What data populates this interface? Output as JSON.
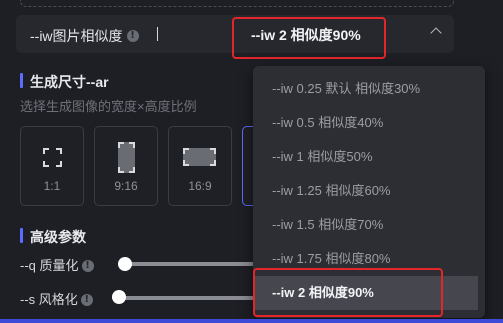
{
  "iw": {
    "label": "--iw图片相似度",
    "info": "!",
    "selected": "--iw 2 相似度90%"
  },
  "size_section": {
    "title": "生成尺寸--ar",
    "subtitle": "选择生成图像的宽度×高度比例",
    "ratios": [
      {
        "label": "1:1"
      },
      {
        "label": "9:16"
      },
      {
        "label": "16:9"
      }
    ]
  },
  "advanced": {
    "title": "高级参数",
    "quality_label": "--q 质量化",
    "quality_level": 0.0,
    "style_label": "--s 风格化",
    "style_level": 0.0
  },
  "dropdown": {
    "options": [
      "--iw 0.25 默认 相似度30%",
      "--iw 0.5 相似度40%",
      "--iw 1 相似度50%",
      "--iw 1.25 相似度60%",
      "--iw 1.5 相似度70%",
      "--iw 1.75 相似度80%",
      "--iw 2 相似度90%"
    ],
    "selected_index": 6
  },
  "colors": {
    "background": "#1e1f24",
    "accent": "#5b6cff",
    "highlight": "#e4262a"
  }
}
